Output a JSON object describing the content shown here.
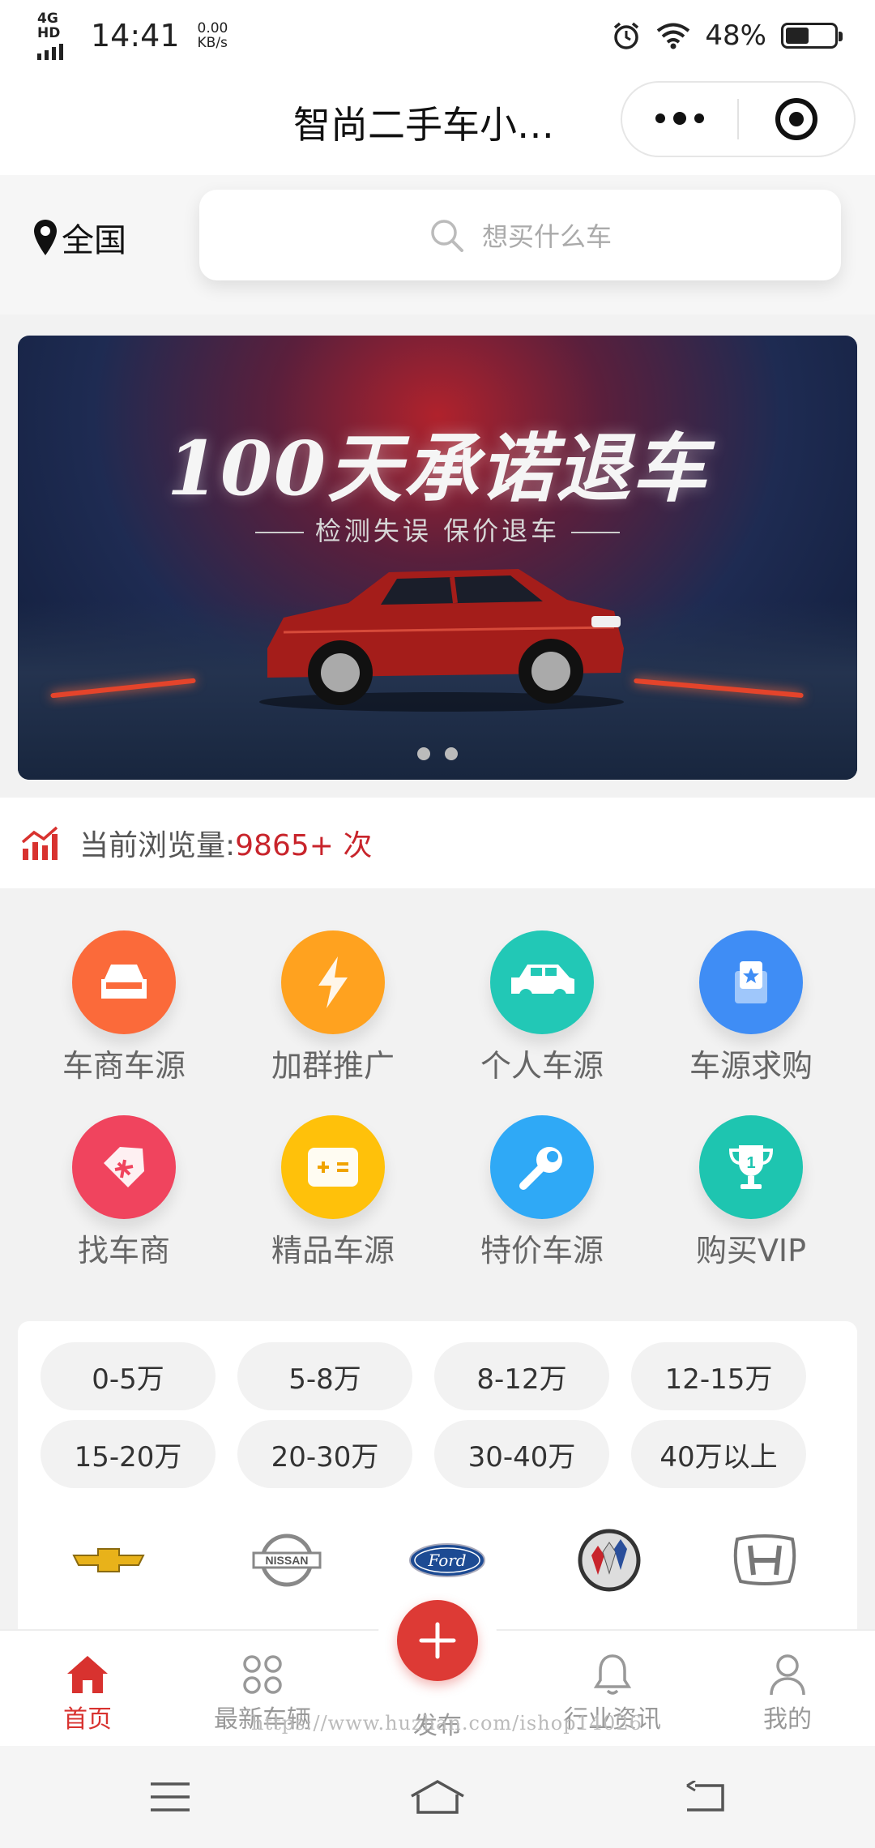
{
  "status_bar": {
    "network": "4G HD",
    "time": "14:41",
    "speed_value": "0.00",
    "speed_unit": "KB/s",
    "battery_percent": "48%",
    "battery_level": 0.48
  },
  "header": {
    "title": "智尚二手车小…"
  },
  "search": {
    "location": "全国",
    "placeholder": "想买什么车"
  },
  "banner": {
    "title": "100天承诺退车",
    "subtitle": "检测失误 保价退车",
    "slide_count": 2
  },
  "views": {
    "label": "当前浏览量:",
    "count": "9865+ 次"
  },
  "categories": [
    {
      "label": "车商车源",
      "icon": "car-front-icon",
      "color": "#fb6a3a"
    },
    {
      "label": "加群推广",
      "icon": "lightning-icon",
      "color": "#ffa21f"
    },
    {
      "label": "个人车源",
      "icon": "suv-icon",
      "color": "#22c8b6"
    },
    {
      "label": "车源求购",
      "icon": "star-card-icon",
      "color": "#3f8df5"
    },
    {
      "label": "找车商",
      "icon": "tag-icon",
      "color": "#f0445e"
    },
    {
      "label": "精品车源",
      "icon": "calculator-icon",
      "color": "#ffc10a"
    },
    {
      "label": "特价车源",
      "icon": "wrench-icon",
      "color": "#2fa9f6"
    },
    {
      "label": "购买VIP",
      "icon": "trophy-icon",
      "color": "#1ec5b0"
    }
  ],
  "price_ranges": [
    "0-5万",
    "5-8万",
    "8-12万",
    "12-15万",
    "15-20万",
    "20-30万",
    "30-40万",
    "40万以上"
  ],
  "brands": [
    {
      "name": "chevrolet-logo-icon"
    },
    {
      "name": "nissan-logo-icon",
      "text": "NISSAN"
    },
    {
      "name": "ford-logo-icon",
      "text": "Ford"
    },
    {
      "name": "buick-logo-icon"
    },
    {
      "name": "honda-logo-icon"
    }
  ],
  "tabs": [
    {
      "label": "首页",
      "icon": "home-icon",
      "active": true
    },
    {
      "label": "最新车辆",
      "icon": "grid-icon",
      "active": false
    },
    {
      "label": "发布",
      "icon": "plus-icon",
      "active": false
    },
    {
      "label": "行业资讯",
      "icon": "bell-icon",
      "active": false
    },
    {
      "label": "我的",
      "icon": "user-icon",
      "active": false
    }
  ],
  "watermark": "https://www.huzhan.com/ishop14026",
  "colors": {
    "accent": "#d8322f",
    "page_bg": "#f2f2f2"
  }
}
